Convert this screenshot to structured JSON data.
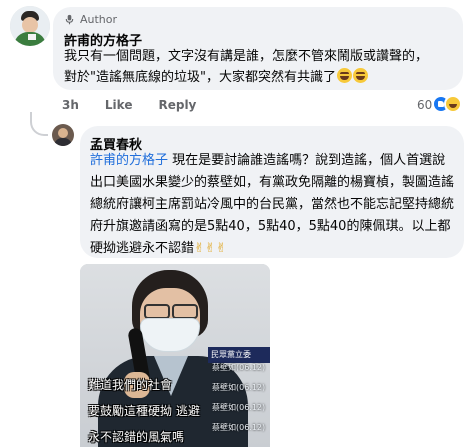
{
  "comment": {
    "author_badge": "Author",
    "name": "許甫的方格子",
    "text_line1": "我只有一個問題，文字沒有講是誰，怎麼不管來鬧版或讚聲的，",
    "text_line2": "對於\"造謠無底線的垃圾\"，大家都突然有共識了",
    "timestamp": "3h",
    "like_label": "Like",
    "reply_label": "Reply",
    "reaction_count": "60",
    "reaction_icons": [
      "like-icon",
      "haha-icon"
    ]
  },
  "reply": {
    "name": "孟買春秋",
    "mention": "許甫的方格子",
    "text": " 現在是要討論誰造謠嗎？說到造謠，個人首選說出口美國水果變少的蔡壁如，有黨政免隔離的楊寶楨，製圖造謠總統府讓柯主席罰站冷風中的台民黨，當然也不能忘記堅持總統府升旗邀請函寫的是5點40，5點40，5點40的陳佩琪。以上都硬拗逃避永不認錯",
    "emoji_glyphs": [
      "✌",
      "✌",
      "✌"
    ]
  },
  "photo": {
    "news_header": "民眾黨立委",
    "news_rows": [
      "蔡壁如(06.12)",
      "蔡壁如(06.12)",
      "蔡壁如(06.12)",
      "蔡壁如(06.12)"
    ],
    "subtitles": [
      "難道我們的社會",
      "要鼓勵這種硬拗 逃避",
      "永不認錯的風氣嗎"
    ]
  },
  "colors": {
    "bubble": "#f0f2f5",
    "mention": "#216fdb",
    "meta_text": "#65676b",
    "like_blue": "#1877f2"
  }
}
